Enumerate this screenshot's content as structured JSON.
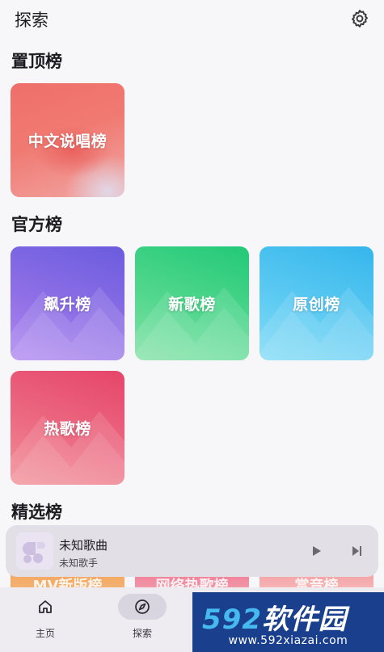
{
  "header": {
    "title": "探索",
    "settings_icon": "gear-icon"
  },
  "sections": {
    "pinned": {
      "title": "置顶榜",
      "cards": [
        {
          "label": "中文说唱榜"
        }
      ]
    },
    "official": {
      "title": "官方榜",
      "cards": [
        {
          "label": "飙升榜",
          "color": "#7b67e3"
        },
        {
          "label": "新歌榜",
          "color": "#3ccf82"
        },
        {
          "label": "原创榜",
          "color": "#4cc2f0"
        },
        {
          "label": "热歌榜",
          "color": "#ea5a77"
        }
      ]
    },
    "featured": {
      "title": "精选榜",
      "cards": [
        {
          "label": "MV新版榜"
        },
        {
          "label": "网络热歌榜"
        },
        {
          "label": "赏音榜"
        }
      ]
    }
  },
  "player": {
    "song_title": "未知歌曲",
    "artist": "未知歌手",
    "play_icon": "play-icon",
    "next_icon": "skip-next-icon"
  },
  "bottom_nav": {
    "items": [
      {
        "label": "主页",
        "icon": "home-icon",
        "active": false
      },
      {
        "label": "探索",
        "icon": "compass-icon",
        "active": true
      }
    ]
  },
  "watermark": {
    "main_num": "592",
    "main_text": "软件园",
    "url": "www.592xiazai.com"
  }
}
